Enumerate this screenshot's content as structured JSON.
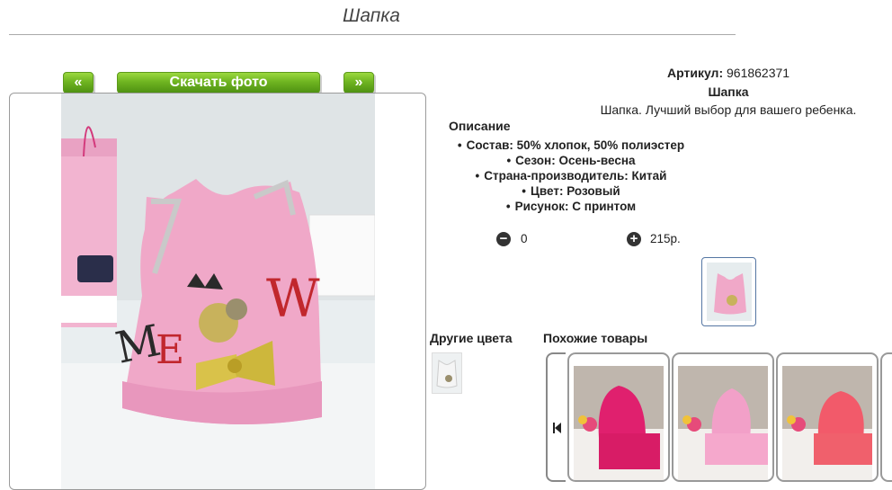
{
  "page": {
    "title": "Шапка"
  },
  "gallery": {
    "prev_label": "«",
    "download_label": "Скачать фото",
    "next_label": "»"
  },
  "product": {
    "sku_label": "Артикул:",
    "sku_value": "961862371",
    "name": "Шапка",
    "short_description": "Шапка. Лучший выбор для вашего ребенка.",
    "description_heading": "Описание",
    "attributes": [
      "Состав: 50% хлопок, 50% полиэстер",
      "Сезон: Осень-весна",
      "Страна-производитель: Китай",
      "Цвет: Розовый",
      "Рисунок: С принтом"
    ],
    "quantity": "0",
    "price": "215р."
  },
  "sections": {
    "other_colors": "Другие цвета",
    "similar_products": "Похожие товары"
  },
  "icons": {
    "minus": "minus-circle-icon",
    "plus": "plus-circle-icon",
    "carousel_prev": "first-page-icon"
  },
  "colors": {
    "button_green": "#6fb521",
    "hat_pink": "#f0a8c8",
    "similar_1": "#e0206e",
    "similar_2": "#f2a0c8",
    "similar_3": "#f25a6a"
  }
}
